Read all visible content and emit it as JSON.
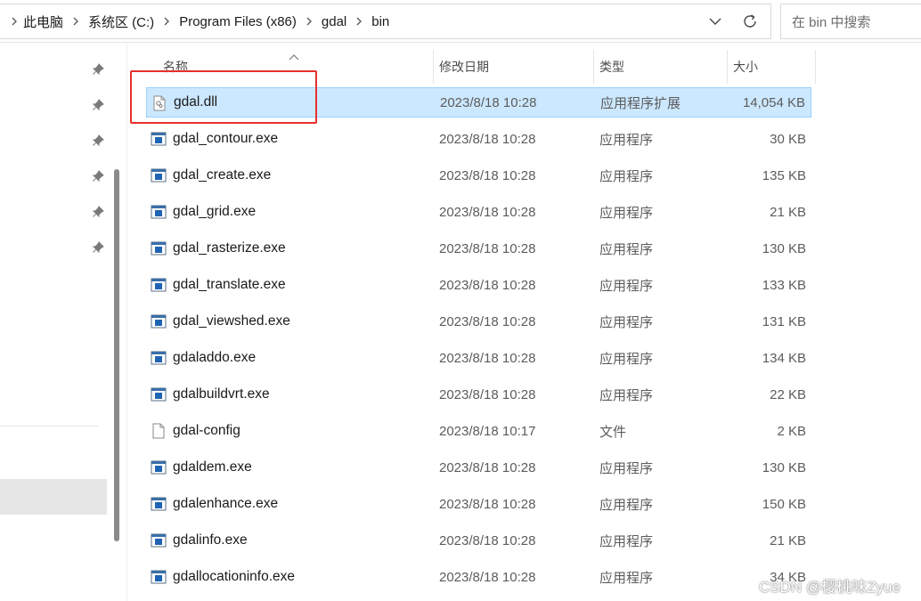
{
  "address_bar": {
    "crumbs": [
      "此电脑",
      "系统区 (C:)",
      "Program Files (x86)",
      "gdal",
      "bin"
    ]
  },
  "search": {
    "placeholder": "在 bin 中搜索"
  },
  "columns": {
    "name": "名称",
    "date": "修改日期",
    "type": "类型",
    "size": "大小"
  },
  "files": [
    {
      "name": "gdal.dll",
      "date": "2023/8/18 10:28",
      "type": "应用程序扩展",
      "size": "14,054 KB",
      "icon": "dll-file-icon",
      "selected": true
    },
    {
      "name": "gdal_contour.exe",
      "date": "2023/8/18 10:28",
      "type": "应用程序",
      "size": "30 KB",
      "icon": "exe-file-icon"
    },
    {
      "name": "gdal_create.exe",
      "date": "2023/8/18 10:28",
      "type": "应用程序",
      "size": "135 KB",
      "icon": "exe-file-icon"
    },
    {
      "name": "gdal_grid.exe",
      "date": "2023/8/18 10:28",
      "type": "应用程序",
      "size": "21 KB",
      "icon": "exe-file-icon"
    },
    {
      "name": "gdal_rasterize.exe",
      "date": "2023/8/18 10:28",
      "type": "应用程序",
      "size": "130 KB",
      "icon": "exe-file-icon"
    },
    {
      "name": "gdal_translate.exe",
      "date": "2023/8/18 10:28",
      "type": "应用程序",
      "size": "133 KB",
      "icon": "exe-file-icon"
    },
    {
      "name": "gdal_viewshed.exe",
      "date": "2023/8/18 10:28",
      "type": "应用程序",
      "size": "131 KB",
      "icon": "exe-file-icon"
    },
    {
      "name": "gdaladdo.exe",
      "date": "2023/8/18 10:28",
      "type": "应用程序",
      "size": "134 KB",
      "icon": "exe-file-icon"
    },
    {
      "name": "gdalbuildvrt.exe",
      "date": "2023/8/18 10:28",
      "type": "应用程序",
      "size": "22 KB",
      "icon": "exe-file-icon"
    },
    {
      "name": "gdal-config",
      "date": "2023/8/18 10:17",
      "type": "文件",
      "size": "2 KB",
      "icon": "blank-file-icon"
    },
    {
      "name": "gdaldem.exe",
      "date": "2023/8/18 10:28",
      "type": "应用程序",
      "size": "130 KB",
      "icon": "exe-file-icon"
    },
    {
      "name": "gdalenhance.exe",
      "date": "2023/8/18 10:28",
      "type": "应用程序",
      "size": "150 KB",
      "icon": "exe-file-icon"
    },
    {
      "name": "gdalinfo.exe",
      "date": "2023/8/18 10:28",
      "type": "应用程序",
      "size": "21 KB",
      "icon": "exe-file-icon"
    },
    {
      "name": "gdallocationinfo.exe",
      "date": "2023/8/18 10:28",
      "type": "应用程序",
      "size": "34 KB",
      "icon": "exe-file-icon"
    }
  ],
  "watermark": "CSDN @樱桃味Zyue",
  "colors": {
    "selection_bg": "#cce8ff",
    "selection_border": "#99d1ff",
    "annotation_red": "#e5302d"
  }
}
